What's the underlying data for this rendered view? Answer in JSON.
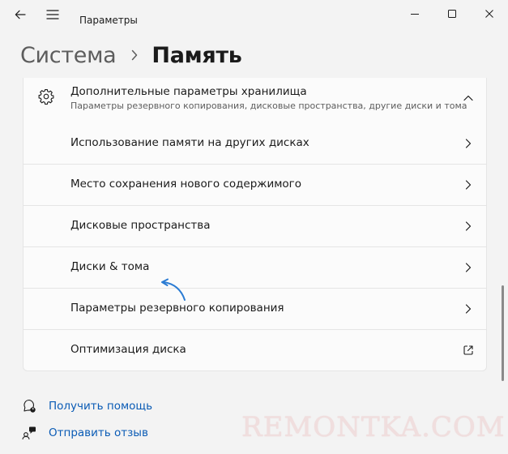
{
  "window": {
    "title": "Параметры"
  },
  "breadcrumb": {
    "parent": "Система",
    "separator_icon": "chevron-right-icon",
    "current": "Память"
  },
  "expander": {
    "icon": "gear-icon",
    "title": "Дополнительные параметры хранилища",
    "subtitle": "Параметры резервного копирования, дисковые пространства, другие диски и тома",
    "expanded": true
  },
  "rows": [
    {
      "label": "Использование памяти на других дисках",
      "icon": "chevron-right-icon"
    },
    {
      "label": "Место сохранения нового содержимого",
      "icon": "chevron-right-icon"
    },
    {
      "label": "Дисковые пространства",
      "icon": "chevron-right-icon"
    },
    {
      "label": "Диски & тома",
      "icon": "chevron-right-icon"
    },
    {
      "label": "Параметры резервного копирования",
      "icon": "chevron-right-icon"
    },
    {
      "label": "Оптимизация диска",
      "icon": "external-link-icon"
    }
  ],
  "footer": {
    "help": "Получить помощь",
    "feedback": "Отправить отзыв"
  },
  "watermark": "REMONTKA.COM",
  "colors": {
    "background": "#f3f3f3",
    "card": "#fbfbfb",
    "link": "#0a5bb5",
    "annotation_arrow": "#2a7bd3"
  }
}
